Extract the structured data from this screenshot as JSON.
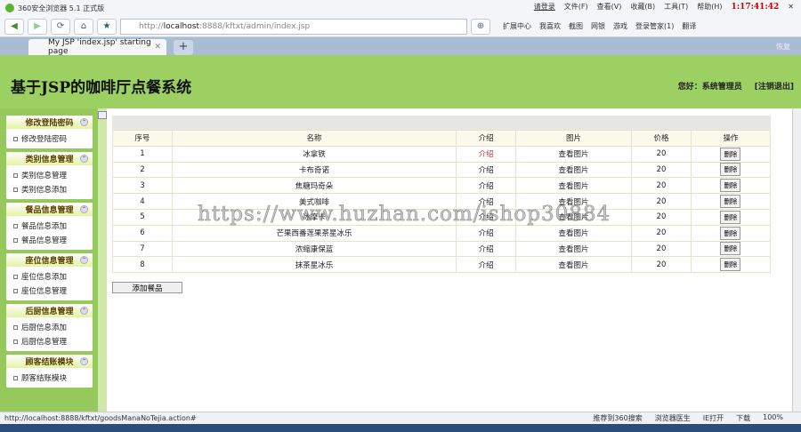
{
  "browser": {
    "title": "360安全浏览器 5.1 正式版",
    "login": "请登录",
    "menus": [
      "文件(F)",
      "查看(V)",
      "收藏(B)",
      "工具(T)",
      "帮助(H)"
    ],
    "clock": "1:17:41:42",
    "url_prefix": "http://",
    "url_host": "localhost",
    "url_rest": ":8888/kftxt/admin/index.jsp",
    "tools": [
      "扩展中心",
      "我喜欢",
      "截图",
      "网银",
      "游戏",
      "登录管家(1)",
      "翻译"
    ],
    "tab_title": "My JSP 'index.jsp' starting page",
    "restore": "恢复",
    "status_url": "http://localhost:8888/kftxt/goodsManaNoTejia.action#",
    "status_items": [
      "推荐到360搜索",
      "浏览器医生",
      "IE打开",
      "下载",
      "100%"
    ]
  },
  "header": {
    "title": "基于JSP的咖啡厅点餐系统",
    "greeting": "您好：系统管理员",
    "logout": "[注销退出]"
  },
  "sidebar": [
    {
      "title": "修改登陆密码",
      "items": [
        "修改登陆密码"
      ]
    },
    {
      "title": "类别信息管理",
      "items": [
        "类别信息管理",
        "类别信息添加"
      ]
    },
    {
      "title": "餐品信息管理",
      "items": [
        "餐品信息添加",
        "餐品信息管理"
      ]
    },
    {
      "title": "座位信息管理",
      "items": [
        "座位信息添加",
        "座位信息管理"
      ]
    },
    {
      "title": "后厨信息管理",
      "items": [
        "后厨信息添加",
        "后厨信息管理"
      ]
    },
    {
      "title": "顾客结账模块",
      "items": [
        "顾客结账模块"
      ]
    }
  ],
  "table": {
    "headers": [
      "序号",
      "名称",
      "介绍",
      "图片",
      "价格",
      "操作"
    ],
    "rows": [
      [
        "1",
        "冰拿铁",
        "介绍",
        "查看图片",
        "20",
        "删除"
      ],
      [
        "2",
        "卡布奇诺",
        "介绍",
        "查看图片",
        "20",
        "删除"
      ],
      [
        "3",
        "焦糖玛奇朵",
        "介绍",
        "查看图片",
        "20",
        "删除"
      ],
      [
        "4",
        "美式咖啡",
        "介绍",
        "查看图片",
        "20",
        "删除"
      ],
      [
        "5",
        "冰摩卡",
        "介绍",
        "查看图片",
        "20",
        "删除"
      ],
      [
        "6",
        "芒果西番莲果茶星冰乐",
        "介绍",
        "查看图片",
        "20",
        "删除"
      ],
      [
        "7",
        "浓缩康保蓝",
        "介绍",
        "查看图片",
        "20",
        "删除"
      ],
      [
        "8",
        "抹茶星冰乐",
        "介绍",
        "查看图片",
        "20",
        "删除"
      ]
    ]
  },
  "add_button": "添加餐品",
  "watermark": "https://www.huzhan.com/ishop30884"
}
